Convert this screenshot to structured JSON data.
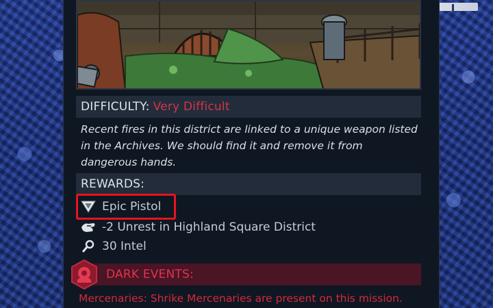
{
  "difficulty": {
    "label": "DIFFICULTY:",
    "value": "Very Difficult"
  },
  "description": "Recent fires in this district are linked to a unique weapon listed in the Archives. We should find it and remove it from dangerous hands.",
  "rewards": {
    "label": "REWARDS:",
    "items": [
      {
        "icon": "weapon-rarity-icon",
        "text": "Epic Pistol"
      },
      {
        "icon": "unrest-fist-icon",
        "text": "-2 Unrest in Highland Square District"
      },
      {
        "icon": "intel-magnifier-icon",
        "text": "30 Intel"
      }
    ]
  },
  "dark_events": {
    "label": "DARK EVENTS:",
    "icon": "dark-event-badge-icon",
    "detail": "Mercenaries: Shrike Mercenaries are present on this mission."
  },
  "colors": {
    "panel_bg": "#0f1722",
    "section_bar": "#232c3b",
    "danger_red": "#d23646",
    "dark_event_bar": "#4a1524",
    "highlight_red": "#e6141e",
    "reward_text": "#c4ccd6"
  }
}
